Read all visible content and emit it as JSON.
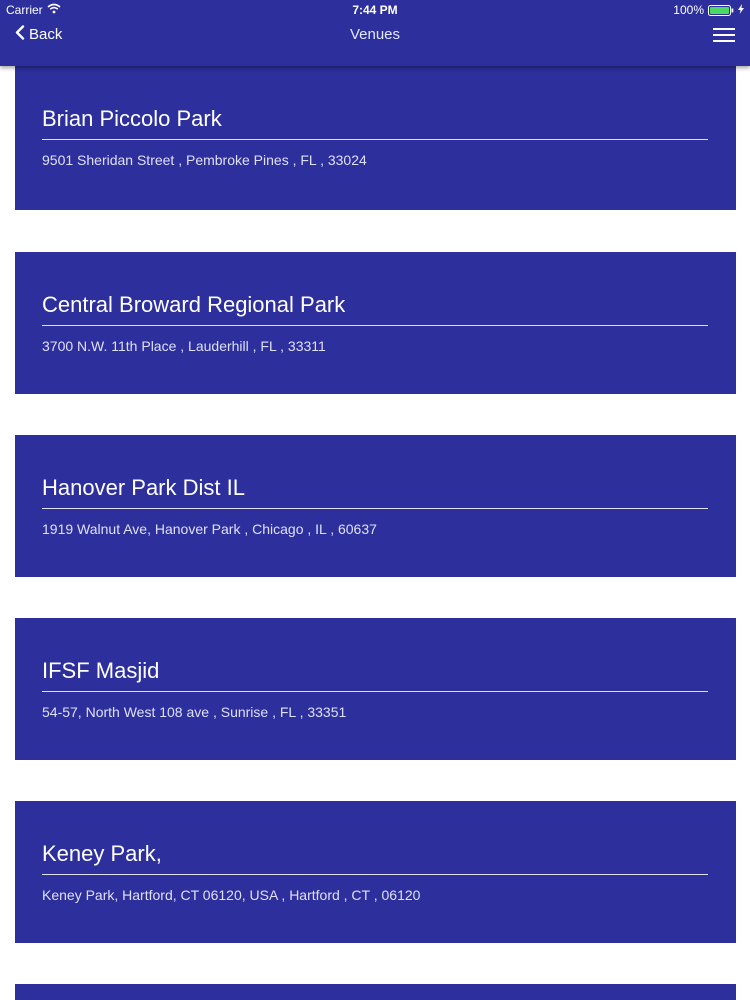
{
  "status_bar": {
    "carrier": "Carrier",
    "time": "7:44 PM",
    "battery_percent": "100%",
    "wifi_icon": "wifi-icon",
    "battery_icon": "battery-icon",
    "charging_icon": "charging-bolt-icon"
  },
  "nav": {
    "back_label": "Back",
    "title": "Venues",
    "back_icon": "chevron-left-icon",
    "menu_icon": "hamburger-menu-icon"
  },
  "colors": {
    "primary": "#2c2f9c",
    "background": "#ffffff",
    "text": "#ffffff"
  },
  "venues": [
    {
      "name": "Brian Piccolo Park",
      "address": "9501 Sheridan Street , Pembroke Pines , FL , 33024"
    },
    {
      "name": "Central Broward Regional Park",
      "address": "3700 N.W. 11th Place , Lauderhill , FL , 33311"
    },
    {
      "name": "Hanover Park Dist IL",
      "address": "1919 Walnut Ave, Hanover Park , Chicago , IL , 60637"
    },
    {
      "name": "IFSF Masjid",
      "address": "54-57, North West 108 ave , Sunrise , FL , 33351"
    },
    {
      "name": "Keney Park,",
      "address": "Keney Park, Hartford, CT 06120, USA , Hartford , CT , 06120"
    },
    {
      "name": "",
      "address": ""
    }
  ]
}
